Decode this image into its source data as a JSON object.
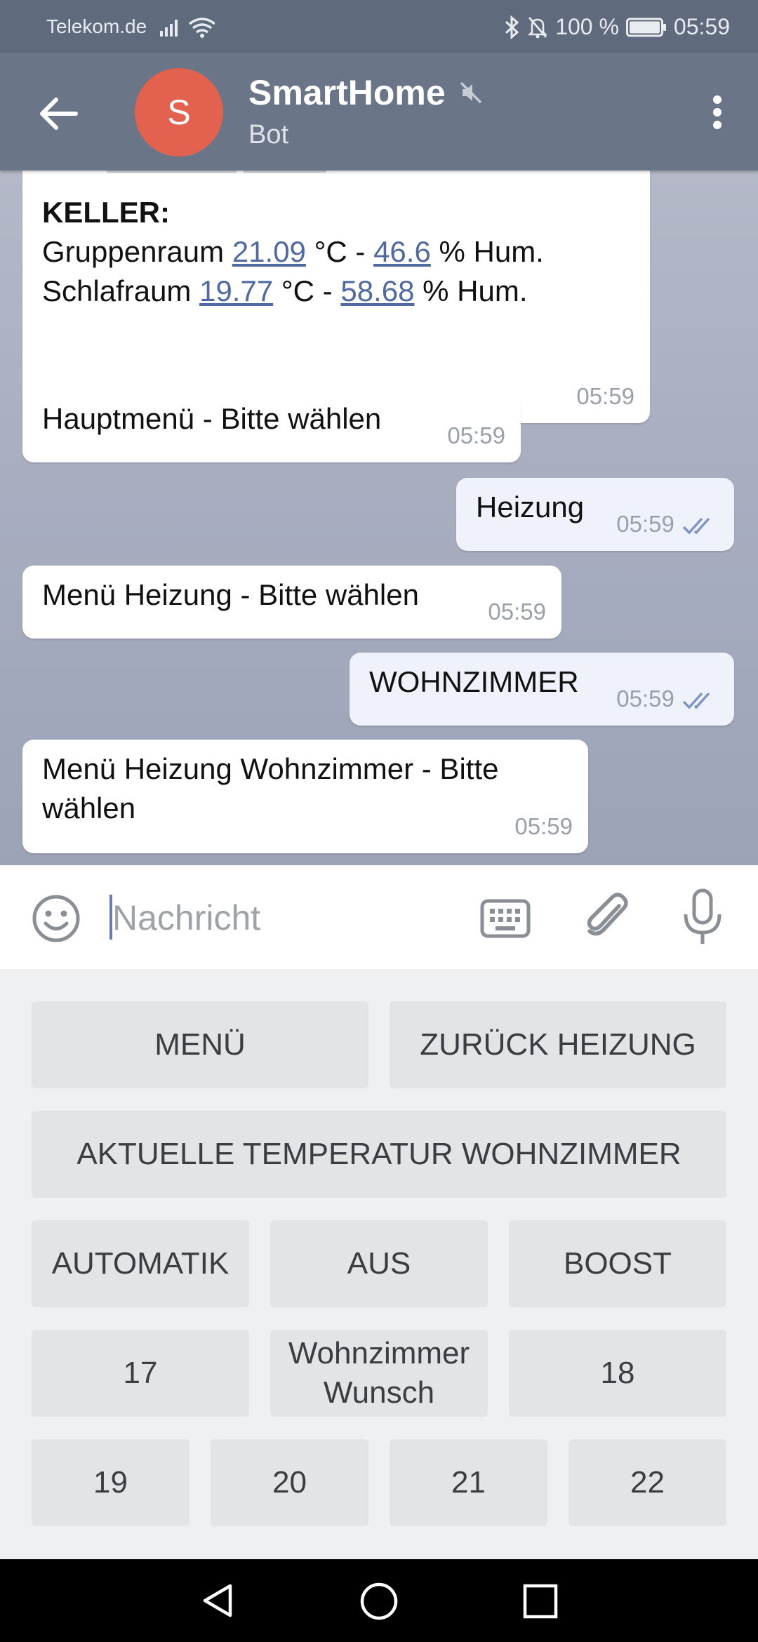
{
  "status_bar": {
    "carrier": "Telekom.de",
    "battery": "100 %",
    "time": "05:59"
  },
  "header": {
    "avatar_letter": "S",
    "title": "SmartHome",
    "subtitle": "Bot"
  },
  "messages": [
    {
      "direction": "incoming",
      "heading": "KELLER:",
      "lines": [
        {
          "room": "Gruppenraum",
          "temp": "21.09",
          "unit": "°C -",
          "hum": "46.6",
          "hum_unit": "% Hum."
        },
        {
          "room": "Schlafraum",
          "temp": "19.77",
          "unit": "°C -",
          "hum": "58.68",
          "hum_unit": "% Hum."
        }
      ],
      "time": "05:59"
    },
    {
      "direction": "incoming",
      "text": "Hauptmenü - Bitte wählen",
      "time": "05:59"
    },
    {
      "direction": "outgoing",
      "text": "Heizung",
      "time": "05:59",
      "read": true
    },
    {
      "direction": "incoming",
      "text": "Menü Heizung - Bitte wählen",
      "time": "05:59"
    },
    {
      "direction": "outgoing",
      "text": "WOHNZIMMER",
      "time": "05:59",
      "read": true
    },
    {
      "direction": "incoming",
      "text_line1": "Menü Heizung Wohnzimmer - Bitte",
      "text_line2": "wählen",
      "time": "05:59"
    }
  ],
  "composer": {
    "placeholder": "Nachricht"
  },
  "keyboard": {
    "row1": [
      "MENÜ",
      "ZURÜCK HEIZUNG"
    ],
    "row2": [
      "AKTUELLE TEMPERATUR WOHNZIMMER"
    ],
    "row3": [
      "AUTOMATIK",
      "AUS",
      "BOOST"
    ],
    "row4": [
      "17",
      "Wohnzimmer Wunsch",
      "18"
    ],
    "row5": [
      "19",
      "20",
      "21",
      "22"
    ]
  },
  "colors": {
    "header": "#6b7588",
    "avatar": "#e2624f",
    "link": "#5069a0",
    "read_ticks": "#7f95c3"
  }
}
